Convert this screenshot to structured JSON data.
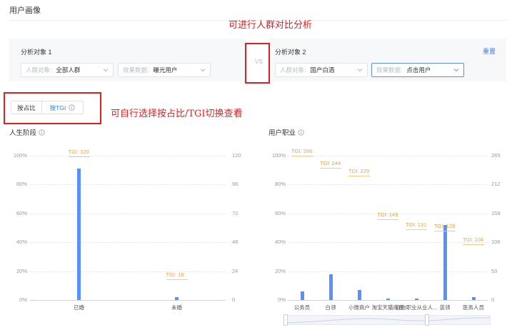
{
  "page": {
    "title": "用户画像"
  },
  "annotations": {
    "top": "可进行人群对比分析",
    "toggle": "可自行选择按占比/TGI切换查看"
  },
  "compare": {
    "object1": {
      "label": "分析对象 1",
      "crowd_prefix": "人群对象:",
      "crowd_value": "全部人群",
      "effect_prefix": "效果数据:",
      "effect_value": "曝光用户"
    },
    "vs": "VS",
    "object2": {
      "label": "分析对象 2",
      "crowd_prefix": "人群对象:",
      "crowd_value": "国产白酒",
      "effect_prefix": "效果数据:",
      "effect_value": "点击用户"
    },
    "reset": "重置"
  },
  "toggle": {
    "ratio": "按占比",
    "tgi": "按TGI",
    "selected": "ratio"
  },
  "colors": {
    "bar": "#5b8ff9",
    "tgi": "#f0a040",
    "annotation": "#e02020",
    "link": "#3b7cf0"
  },
  "chart_data": [
    {
      "type": "bar",
      "title": "人生阶段",
      "categories": [
        "已婚",
        "未婚"
      ],
      "values": [
        91,
        2
      ],
      "tgi": [
        120,
        18
      ],
      "tgi_labels": [
        "TGI: 120",
        "TGI: 18"
      ],
      "y_ticks": [
        "100%",
        "80%",
        "60%",
        "40%",
        "20%",
        "0%"
      ],
      "y2_ticks": [
        "120",
        "96",
        "72",
        "48",
        "24",
        "0"
      ],
      "ylim": [
        0,
        100
      ],
      "y2lim": [
        0,
        120
      ]
    },
    {
      "type": "bar",
      "title": "用户职业",
      "categories": [
        "公务员",
        "白领",
        "小微商户",
        "淘宝天猫商家",
        "自由职业从业人...",
        "蓝领",
        "医务人员"
      ],
      "x_tick_labels": [
        "公务员",
        "白领",
        "小微商户",
        "淘宝天猫商家",
        "自由职业从业人...",
        "蓝领",
        "医务人员"
      ],
      "values": [
        6,
        18,
        7,
        1,
        1,
        52,
        2
      ],
      "tgi": [
        266,
        244,
        229,
        149,
        131,
        128,
        104
      ],
      "tgi_labels": [
        "TGI: 266",
        "TGI: 244",
        "TGI: 229",
        "TGI: 149",
        "TGI: 131",
        "TGI: 128",
        "TGI: 104"
      ],
      "y_ticks": [
        "100%",
        "80%",
        "60%",
        "40%",
        "20%",
        "0%"
      ],
      "y2_ticks": [
        "265",
        "212",
        "159",
        "106",
        "53",
        "0"
      ],
      "ylim": [
        0,
        100
      ],
      "y2lim": [
        0,
        265
      ]
    }
  ]
}
